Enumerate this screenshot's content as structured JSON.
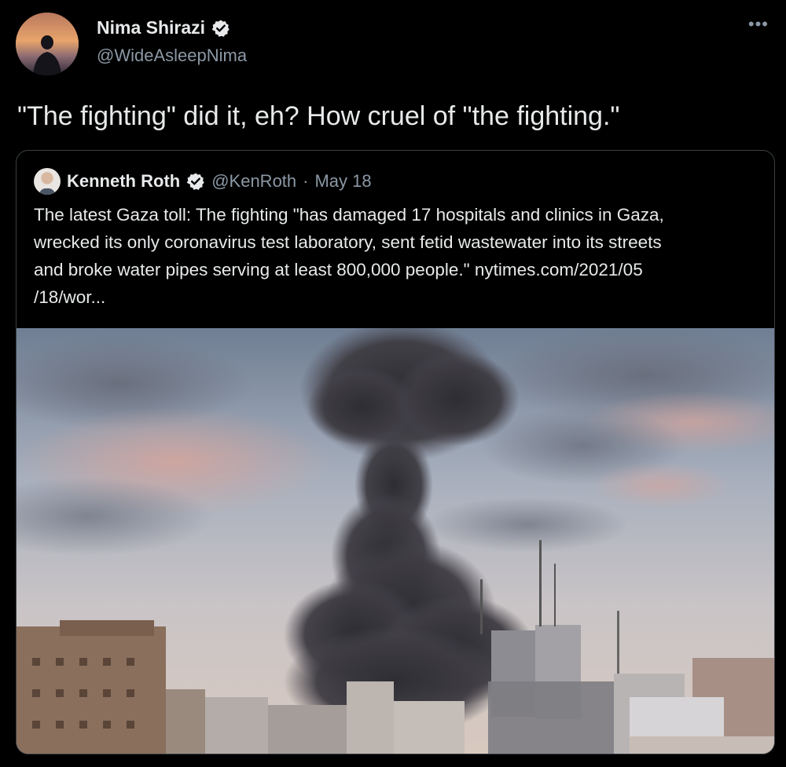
{
  "author": {
    "name": "Nima Shirazi",
    "handle": "@WideAsleepNima",
    "verified_icon": "verified-badge-icon"
  },
  "more_label": "•••",
  "tweet_text": "\"The fighting\" did it, eh? How cruel of \"the fighting.\"",
  "quoted": {
    "name": "Kenneth Roth",
    "handle": "@KenRoth",
    "separator": "·",
    "date": "May 18",
    "body_lines": [
      "The latest Gaza toll: The fighting \"has damaged 17 hospitals and clinics in Gaza,",
      "wrecked its only coronavirus test laboratory, sent fetid wastewater into its streets",
      "and broke water pipes serving at least 800,000 people.\" nytimes.com/2021/05",
      "/18/wor..."
    ]
  },
  "colors": {
    "background": "#000000",
    "text": "#e7e9ea",
    "secondary": "#8b98a5",
    "border": "#3a3f44"
  }
}
